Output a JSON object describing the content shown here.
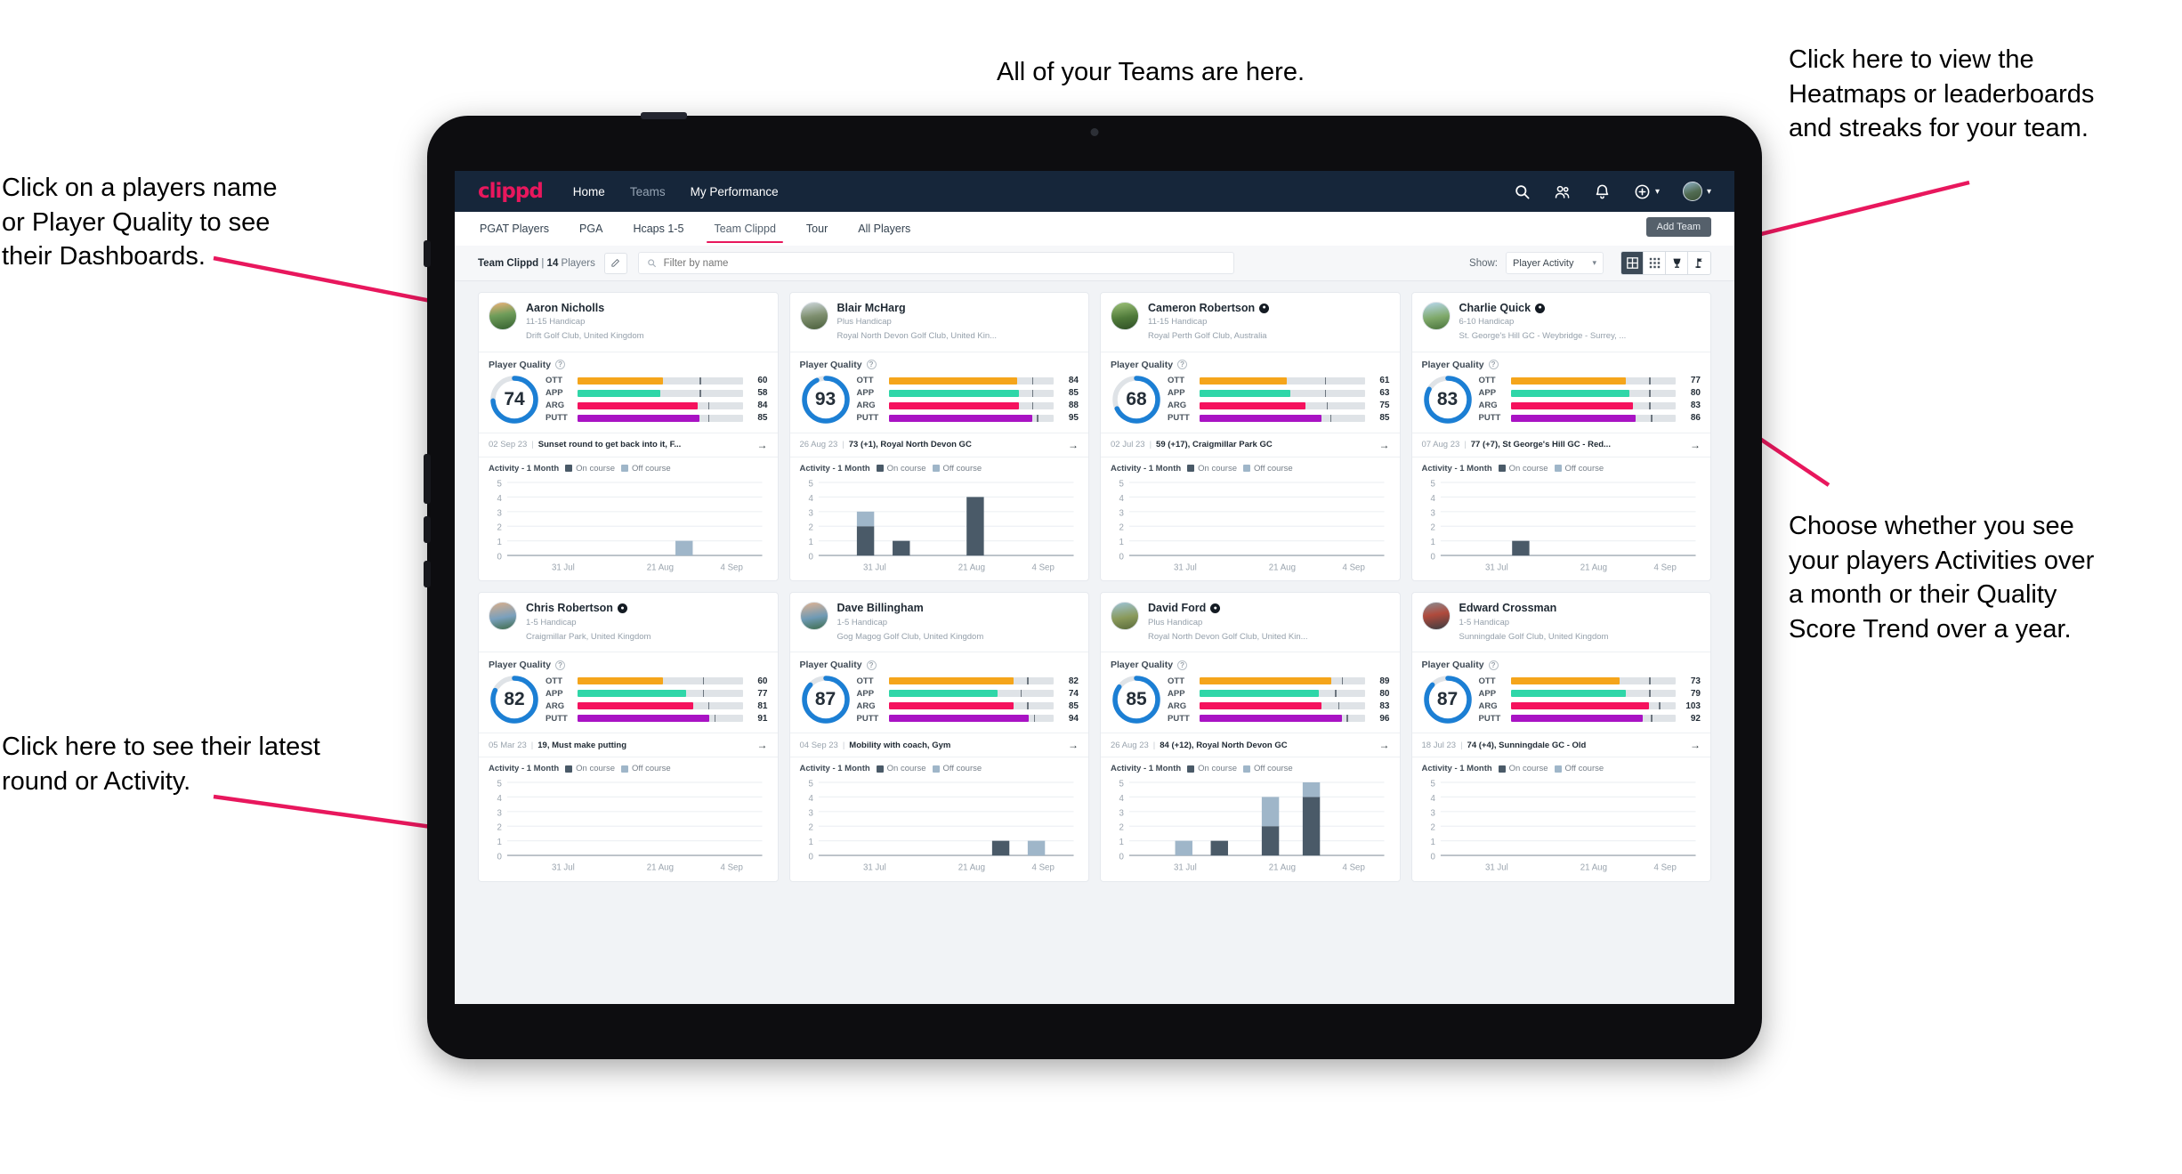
{
  "annotations": {
    "top": "All of your Teams are here.",
    "top_right": "Click here to view the\nHeatmaps or leaderboards\nand streaks for your team.",
    "mid_right": "Choose whether you see\nyour players Activities over\na month or their Quality\nScore Trend over a year.",
    "top_left": "Click on a players name\nor Player Quality to see\ntheir Dashboards.",
    "bottom_left": "Click here to see their latest\nround or Activity.",
    "accent_color": "#e8175d"
  },
  "topnav": {
    "brand": "clippd",
    "links": [
      {
        "label": "Home",
        "active": true
      },
      {
        "label": "Teams",
        "active": false
      },
      {
        "label": "My Performance",
        "active": true
      }
    ],
    "icons": [
      "search-icon",
      "people-icon",
      "bell-icon",
      "plus-circle-icon",
      "avatar"
    ],
    "background": "#16263a"
  },
  "subtabs": {
    "items": [
      {
        "label": "PGAT Players",
        "active": false
      },
      {
        "label": "PGA",
        "active": false
      },
      {
        "label": "Hcaps 1-5",
        "active": false
      },
      {
        "label": "Team Clippd",
        "active": true
      },
      {
        "label": "Tour",
        "active": false
      },
      {
        "label": "All Players",
        "active": false
      }
    ],
    "add_team_label": "Add Team"
  },
  "filterbar": {
    "team_name": "Team Clippd",
    "team_sep": " | ",
    "player_count": "14",
    "players_word": " Players",
    "edit_icon": "pencil-icon",
    "search_placeholder": "Filter by name",
    "search_value": "",
    "show_label": "Show:",
    "show_value": "Player Activity",
    "view_buttons": [
      {
        "name": "grid-large-view",
        "active": true
      },
      {
        "name": "grid-small-view",
        "active": false
      },
      {
        "name": "heatmap-view",
        "active": false
      },
      {
        "name": "leaderboard-view",
        "active": false
      }
    ]
  },
  "card_labels": {
    "player_quality": "Player Quality",
    "activity": "Activity - 1 Month",
    "legend_on": "On course",
    "legend_off": "Off course",
    "metrics": [
      "OTT",
      "APP",
      "ARG",
      "PUTT"
    ]
  },
  "metric_colors": {
    "OTT": "#f5a51b",
    "APP": "#2fd6a8",
    "ARG": "#f5125e",
    "PUTT": "#a913c4",
    "ring": "#1c7fd4",
    "ring_track": "#dfe3e7"
  },
  "chart_data": {
    "type": "bar",
    "title": "Activity - 1 Month",
    "xlabel": "",
    "ylabel": "",
    "ylim": [
      0,
      5
    ],
    "yticks": [
      0,
      1,
      2,
      3,
      4,
      5
    ],
    "xticks": [
      "31 Jul",
      "21 Aug",
      "4 Sep"
    ],
    "legend": [
      "On course",
      "Off course"
    ],
    "legend_position": "top",
    "grid": true,
    "stacked": true,
    "panels": [
      {
        "player": "Aaron Nicholls",
        "bars": [
          {
            "x": 0.66,
            "on": 0,
            "off": 1
          }
        ]
      },
      {
        "player": "Blair McHarg",
        "bars": [
          {
            "x": 0.15,
            "on": 2,
            "off": 1
          },
          {
            "x": 0.29,
            "on": 1,
            "off": 0
          },
          {
            "x": 0.58,
            "on": 4,
            "off": 0
          }
        ]
      },
      {
        "player": "Cameron Robertson",
        "bars": []
      },
      {
        "player": "Charlie Quick",
        "bars": [
          {
            "x": 0.28,
            "on": 1,
            "off": 0
          }
        ]
      },
      {
        "player": "Chris Robertson",
        "bars": []
      },
      {
        "player": "Dave Billingham",
        "bars": [
          {
            "x": 0.68,
            "on": 1,
            "off": 0
          },
          {
            "x": 0.82,
            "on": 0,
            "off": 1
          }
        ]
      },
      {
        "player": "David Ford",
        "bars": [
          {
            "x": 0.18,
            "on": 0,
            "off": 1
          },
          {
            "x": 0.32,
            "on": 1,
            "off": 0
          },
          {
            "x": 0.52,
            "on": 2,
            "off": 2
          },
          {
            "x": 0.68,
            "on": 4,
            "off": 1
          }
        ]
      },
      {
        "player": "Edward Crossman",
        "bars": []
      }
    ]
  },
  "players": [
    {
      "name": "Aaron Nicholls",
      "verified": false,
      "handicap": "11-15 Handicap",
      "club": "Drift Golf Club, United Kingdom",
      "quality": 74,
      "metrics": [
        {
          "label": "OTT",
          "value": 60,
          "fill": 0.52,
          "tick": 0.74
        },
        {
          "label": "APP",
          "value": 58,
          "fill": 0.5,
          "tick": 0.74
        },
        {
          "label": "ARG",
          "value": 84,
          "fill": 0.73,
          "tick": 0.79
        },
        {
          "label": "PUTT",
          "value": 85,
          "fill": 0.74,
          "tick": 0.79
        }
      ],
      "latest_date": "02 Sep 23",
      "latest_text": "Sunset round to get back into it, F..."
    },
    {
      "name": "Blair McHarg",
      "verified": false,
      "handicap": "Plus Handicap",
      "club": "Royal North Devon Golf Club, United Kin...",
      "quality": 93,
      "metrics": [
        {
          "label": "OTT",
          "value": 84,
          "fill": 0.78,
          "tick": 0.87
        },
        {
          "label": "APP",
          "value": 85,
          "fill": 0.79,
          "tick": 0.87
        },
        {
          "label": "ARG",
          "value": 88,
          "fill": 0.79,
          "tick": 0.87
        },
        {
          "label": "PUTT",
          "value": 95,
          "fill": 0.87,
          "tick": 0.9
        }
      ],
      "latest_date": "26 Aug 23",
      "latest_text": "73 (+1), Royal North Devon GC"
    },
    {
      "name": "Cameron Robertson",
      "verified": true,
      "handicap": "11-15 Handicap",
      "club": "Royal Perth Golf Club, Australia",
      "quality": 68,
      "metrics": [
        {
          "label": "OTT",
          "value": 61,
          "fill": 0.53,
          "tick": 0.76
        },
        {
          "label": "APP",
          "value": 63,
          "fill": 0.55,
          "tick": 0.76
        },
        {
          "label": "ARG",
          "value": 75,
          "fill": 0.64,
          "tick": 0.77
        },
        {
          "label": "PUTT",
          "value": 85,
          "fill": 0.74,
          "tick": 0.79
        }
      ],
      "latest_date": "02 Jul 23",
      "latest_text": "59 (+17), Craigmillar Park GC"
    },
    {
      "name": "Charlie Quick",
      "verified": true,
      "handicap": "6-10 Handicap",
      "club": "St. George's Hill GC - Weybridge - Surrey, ...",
      "quality": 83,
      "metrics": [
        {
          "label": "OTT",
          "value": 77,
          "fill": 0.7,
          "tick": 0.84
        },
        {
          "label": "APP",
          "value": 80,
          "fill": 0.72,
          "tick": 0.84
        },
        {
          "label": "ARG",
          "value": 83,
          "fill": 0.74,
          "tick": 0.84
        },
        {
          "label": "PUTT",
          "value": 86,
          "fill": 0.76,
          "tick": 0.85
        }
      ],
      "latest_date": "07 Aug 23",
      "latest_text": "77 (+7), St George's Hill GC - Red..."
    },
    {
      "name": "Chris Robertson",
      "verified": true,
      "handicap": "1-5 Handicap",
      "club": "Craigmillar Park, United Kingdom",
      "quality": 82,
      "metrics": [
        {
          "label": "OTT",
          "value": 60,
          "fill": 0.52,
          "tick": 0.76
        },
        {
          "label": "APP",
          "value": 77,
          "fill": 0.66,
          "tick": 0.76
        },
        {
          "label": "ARG",
          "value": 81,
          "fill": 0.7,
          "tick": 0.79
        },
        {
          "label": "PUTT",
          "value": 91,
          "fill": 0.8,
          "tick": 0.83
        }
      ],
      "latest_date": "05 Mar 23",
      "latest_text": "19, Must make putting"
    },
    {
      "name": "Dave Billingham",
      "verified": false,
      "handicap": "1-5 Handicap",
      "club": "Gog Magog Golf Club, United Kingdom",
      "quality": 87,
      "metrics": [
        {
          "label": "OTT",
          "value": 82,
          "fill": 0.76,
          "tick": 0.84
        },
        {
          "label": "APP",
          "value": 74,
          "fill": 0.66,
          "tick": 0.8
        },
        {
          "label": "ARG",
          "value": 85,
          "fill": 0.76,
          "tick": 0.84
        },
        {
          "label": "PUTT",
          "value": 94,
          "fill": 0.85,
          "tick": 0.88
        }
      ],
      "latest_date": "04 Sep 23",
      "latest_text": "Mobility with coach, Gym"
    },
    {
      "name": "David Ford",
      "verified": true,
      "handicap": "Plus Handicap",
      "club": "Royal North Devon Golf Club, United Kin...",
      "quality": 85,
      "metrics": [
        {
          "label": "OTT",
          "value": 89,
          "fill": 0.8,
          "tick": 0.86
        },
        {
          "label": "APP",
          "value": 80,
          "fill": 0.72,
          "tick": 0.82
        },
        {
          "label": "ARG",
          "value": 83,
          "fill": 0.74,
          "tick": 0.84
        },
        {
          "label": "PUTT",
          "value": 96,
          "fill": 0.86,
          "tick": 0.89
        }
      ],
      "latest_date": "26 Aug 23",
      "latest_text": "84 (+12), Royal North Devon GC"
    },
    {
      "name": "Edward Crossman",
      "verified": false,
      "handicap": "1-5 Handicap",
      "club": "Sunningdale Golf Club, United Kingdom",
      "quality": 87,
      "metrics": [
        {
          "label": "OTT",
          "value": 73,
          "fill": 0.66,
          "tick": 0.84
        },
        {
          "label": "APP",
          "value": 79,
          "fill": 0.7,
          "tick": 0.84
        },
        {
          "label": "ARG",
          "value": 103,
          "fill": 0.84,
          "tick": 0.9
        },
        {
          "label": "PUTT",
          "value": 92,
          "fill": 0.8,
          "tick": 0.85
        }
      ],
      "latest_date": "18 Jul 23",
      "latest_text": "74 (+4), Sunningdale GC - Old"
    }
  ]
}
